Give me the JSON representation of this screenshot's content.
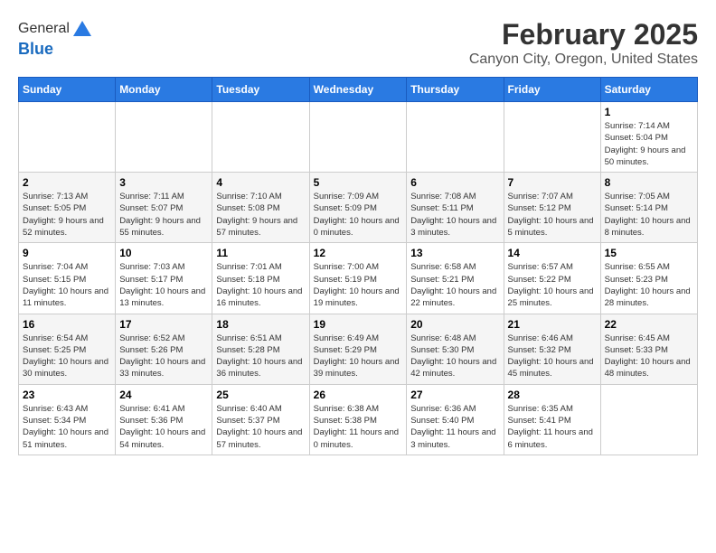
{
  "header": {
    "logo_line1": "General",
    "logo_line2": "Blue",
    "title": "February 2025",
    "subtitle": "Canyon City, Oregon, United States"
  },
  "weekdays": [
    "Sunday",
    "Monday",
    "Tuesday",
    "Wednesday",
    "Thursday",
    "Friday",
    "Saturday"
  ],
  "weeks": [
    [
      {
        "day": "",
        "info": ""
      },
      {
        "day": "",
        "info": ""
      },
      {
        "day": "",
        "info": ""
      },
      {
        "day": "",
        "info": ""
      },
      {
        "day": "",
        "info": ""
      },
      {
        "day": "",
        "info": ""
      },
      {
        "day": "1",
        "info": "Sunrise: 7:14 AM\nSunset: 5:04 PM\nDaylight: 9 hours and 50 minutes."
      }
    ],
    [
      {
        "day": "2",
        "info": "Sunrise: 7:13 AM\nSunset: 5:05 PM\nDaylight: 9 hours and 52 minutes."
      },
      {
        "day": "3",
        "info": "Sunrise: 7:11 AM\nSunset: 5:07 PM\nDaylight: 9 hours and 55 minutes."
      },
      {
        "day": "4",
        "info": "Sunrise: 7:10 AM\nSunset: 5:08 PM\nDaylight: 9 hours and 57 minutes."
      },
      {
        "day": "5",
        "info": "Sunrise: 7:09 AM\nSunset: 5:09 PM\nDaylight: 10 hours and 0 minutes."
      },
      {
        "day": "6",
        "info": "Sunrise: 7:08 AM\nSunset: 5:11 PM\nDaylight: 10 hours and 3 minutes."
      },
      {
        "day": "7",
        "info": "Sunrise: 7:07 AM\nSunset: 5:12 PM\nDaylight: 10 hours and 5 minutes."
      },
      {
        "day": "8",
        "info": "Sunrise: 7:05 AM\nSunset: 5:14 PM\nDaylight: 10 hours and 8 minutes."
      }
    ],
    [
      {
        "day": "9",
        "info": "Sunrise: 7:04 AM\nSunset: 5:15 PM\nDaylight: 10 hours and 11 minutes."
      },
      {
        "day": "10",
        "info": "Sunrise: 7:03 AM\nSunset: 5:17 PM\nDaylight: 10 hours and 13 minutes."
      },
      {
        "day": "11",
        "info": "Sunrise: 7:01 AM\nSunset: 5:18 PM\nDaylight: 10 hours and 16 minutes."
      },
      {
        "day": "12",
        "info": "Sunrise: 7:00 AM\nSunset: 5:19 PM\nDaylight: 10 hours and 19 minutes."
      },
      {
        "day": "13",
        "info": "Sunrise: 6:58 AM\nSunset: 5:21 PM\nDaylight: 10 hours and 22 minutes."
      },
      {
        "day": "14",
        "info": "Sunrise: 6:57 AM\nSunset: 5:22 PM\nDaylight: 10 hours and 25 minutes."
      },
      {
        "day": "15",
        "info": "Sunrise: 6:55 AM\nSunset: 5:23 PM\nDaylight: 10 hours and 28 minutes."
      }
    ],
    [
      {
        "day": "16",
        "info": "Sunrise: 6:54 AM\nSunset: 5:25 PM\nDaylight: 10 hours and 30 minutes."
      },
      {
        "day": "17",
        "info": "Sunrise: 6:52 AM\nSunset: 5:26 PM\nDaylight: 10 hours and 33 minutes."
      },
      {
        "day": "18",
        "info": "Sunrise: 6:51 AM\nSunset: 5:28 PM\nDaylight: 10 hours and 36 minutes."
      },
      {
        "day": "19",
        "info": "Sunrise: 6:49 AM\nSunset: 5:29 PM\nDaylight: 10 hours and 39 minutes."
      },
      {
        "day": "20",
        "info": "Sunrise: 6:48 AM\nSunset: 5:30 PM\nDaylight: 10 hours and 42 minutes."
      },
      {
        "day": "21",
        "info": "Sunrise: 6:46 AM\nSunset: 5:32 PM\nDaylight: 10 hours and 45 minutes."
      },
      {
        "day": "22",
        "info": "Sunrise: 6:45 AM\nSunset: 5:33 PM\nDaylight: 10 hours and 48 minutes."
      }
    ],
    [
      {
        "day": "23",
        "info": "Sunrise: 6:43 AM\nSunset: 5:34 PM\nDaylight: 10 hours and 51 minutes."
      },
      {
        "day": "24",
        "info": "Sunrise: 6:41 AM\nSunset: 5:36 PM\nDaylight: 10 hours and 54 minutes."
      },
      {
        "day": "25",
        "info": "Sunrise: 6:40 AM\nSunset: 5:37 PM\nDaylight: 10 hours and 57 minutes."
      },
      {
        "day": "26",
        "info": "Sunrise: 6:38 AM\nSunset: 5:38 PM\nDaylight: 11 hours and 0 minutes."
      },
      {
        "day": "27",
        "info": "Sunrise: 6:36 AM\nSunset: 5:40 PM\nDaylight: 11 hours and 3 minutes."
      },
      {
        "day": "28",
        "info": "Sunrise: 6:35 AM\nSunset: 5:41 PM\nDaylight: 11 hours and 6 minutes."
      },
      {
        "day": "",
        "info": ""
      }
    ]
  ]
}
